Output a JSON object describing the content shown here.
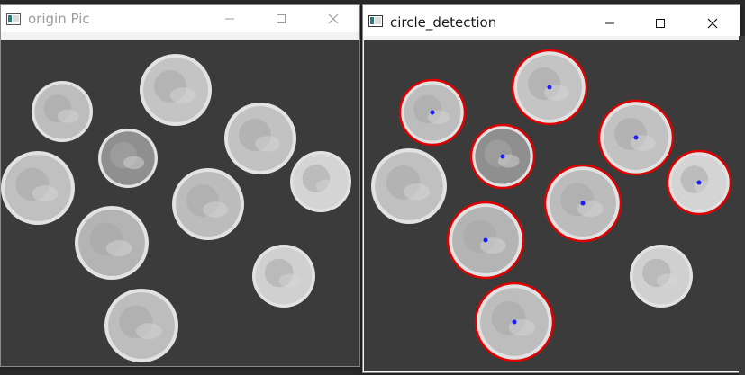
{
  "windows": {
    "origin": {
      "title": "origin Pic"
    },
    "detection": {
      "title": "circle_detection"
    }
  },
  "colors": {
    "background": "#3b3b3b",
    "coin_fill": "#b9b9b9",
    "coin_rim": "#e2e2e2",
    "detected_circle": "#e00000",
    "center_dot": "#1a1aff"
  },
  "icons": [
    "app-icon",
    "minimize-icon",
    "maximize-icon",
    "close-icon"
  ]
}
